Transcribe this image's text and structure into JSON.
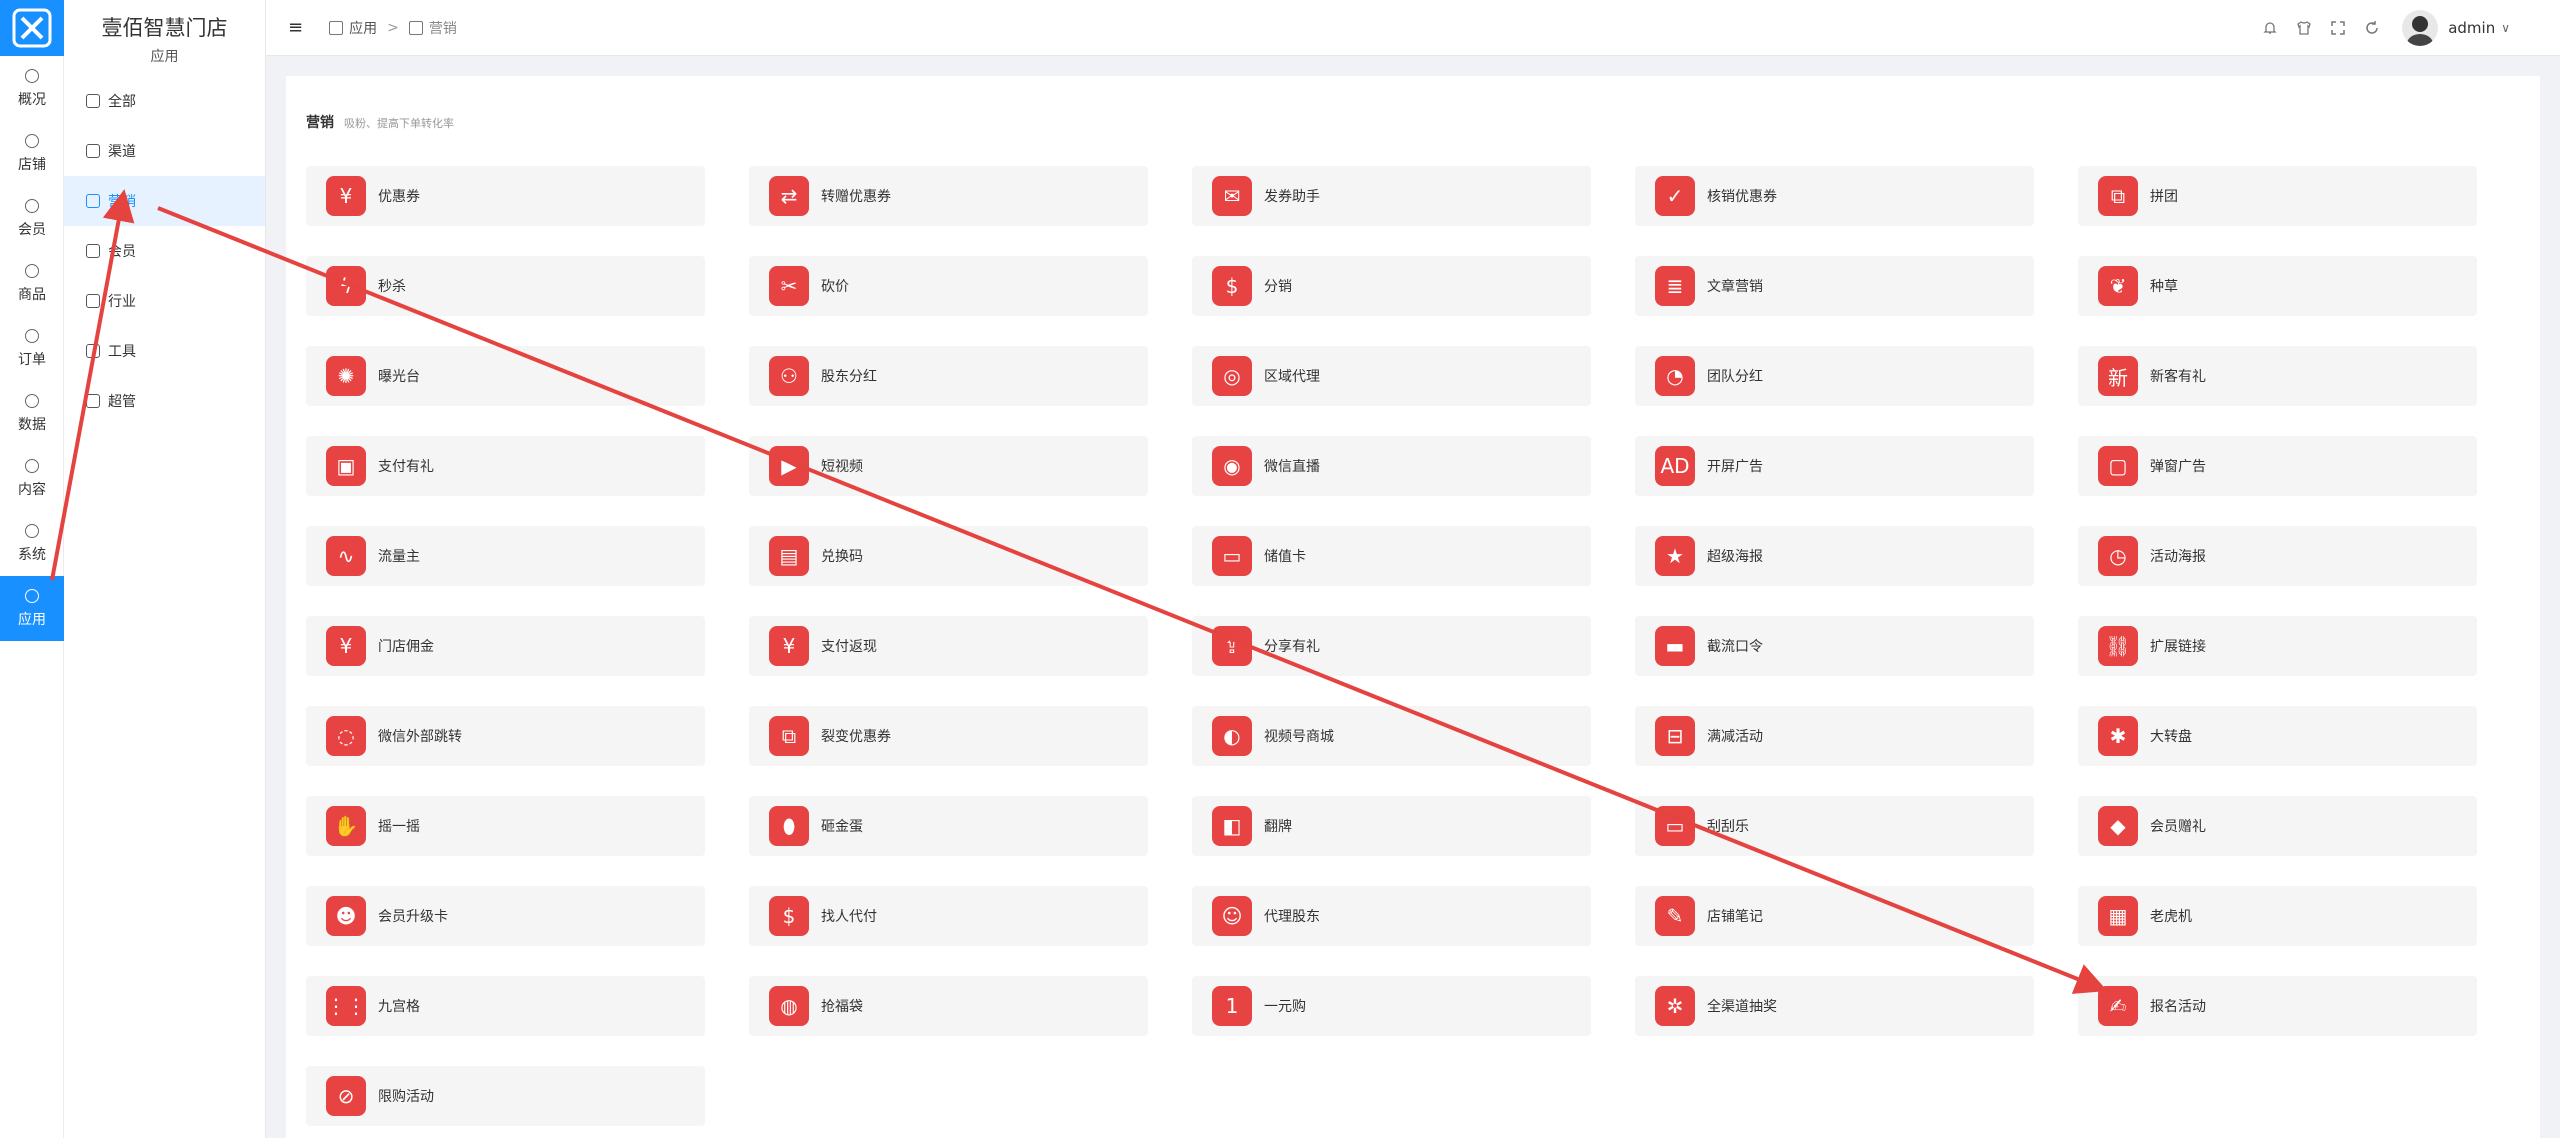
{
  "rail": {
    "items": [
      {
        "label": "概况"
      },
      {
        "label": "店铺"
      },
      {
        "label": "会员"
      },
      {
        "label": "商品"
      },
      {
        "label": "订单"
      },
      {
        "label": "数据"
      },
      {
        "label": "内容"
      },
      {
        "label": "系统"
      },
      {
        "label": "应用",
        "active": true
      }
    ]
  },
  "sidebar": {
    "title": "壹佰智慧门店",
    "subtitle": "应用",
    "items": [
      {
        "label": "全部"
      },
      {
        "label": "渠道"
      },
      {
        "label": "营销",
        "active": true
      },
      {
        "label": "会员"
      },
      {
        "label": "行业"
      },
      {
        "label": "工具"
      },
      {
        "label": "超管"
      }
    ]
  },
  "topbar": {
    "menu_icon": "≡",
    "breadcrumb": [
      "应用",
      "营销"
    ],
    "separator": ">",
    "user": "admin",
    "user_caret": "∨"
  },
  "section": {
    "title": "营销",
    "description": "吸粉、提高下单转化率"
  },
  "apps": [
    {
      "label": "优惠券",
      "icon": "¥"
    },
    {
      "label": "转赠优惠券",
      "icon": "⇄"
    },
    {
      "label": "发券助手",
      "icon": "✉"
    },
    {
      "label": "核销优惠券",
      "icon": "✓"
    },
    {
      "label": "拼团",
      "icon": "⧉"
    },
    {
      "label": "秒杀",
      "icon": "ϟ"
    },
    {
      "label": "砍价",
      "icon": "✂"
    },
    {
      "label": "分销",
      "icon": "$"
    },
    {
      "label": "文章营销",
      "icon": "≣"
    },
    {
      "label": "种草",
      "icon": "❦"
    },
    {
      "label": "曝光台",
      "icon": "✺"
    },
    {
      "label": "股东分红",
      "icon": "⚇"
    },
    {
      "label": "区域代理",
      "icon": "◎"
    },
    {
      "label": "团队分红",
      "icon": "◔"
    },
    {
      "label": "新客有礼",
      "icon": "新"
    },
    {
      "label": "支付有礼",
      "icon": "▣"
    },
    {
      "label": "短视频",
      "icon": "▶"
    },
    {
      "label": "微信直播",
      "icon": "◉"
    },
    {
      "label": "开屏广告",
      "icon": "AD"
    },
    {
      "label": "弹窗广告",
      "icon": "▢"
    },
    {
      "label": "流量主",
      "icon": "∿"
    },
    {
      "label": "兑换码",
      "icon": "▤"
    },
    {
      "label": "储值卡",
      "icon": "▭"
    },
    {
      "label": "超级海报",
      "icon": "★"
    },
    {
      "label": "活动海报",
      "icon": "◷"
    },
    {
      "label": "门店佣金",
      "icon": "¥"
    },
    {
      "label": "支付返现",
      "icon": "¥"
    },
    {
      "label": "分享有礼",
      "icon": "⇪"
    },
    {
      "label": "截流口令",
      "icon": "▬"
    },
    {
      "label": "扩展链接",
      "icon": "⛓"
    },
    {
      "label": "微信外部跳转",
      "icon": "◌"
    },
    {
      "label": "裂变优惠券",
      "icon": "⧉"
    },
    {
      "label": "视频号商城",
      "icon": "◐"
    },
    {
      "label": "满减活动",
      "icon": "⊟"
    },
    {
      "label": "大转盘",
      "icon": "✱"
    },
    {
      "label": "摇一摇",
      "icon": "✋"
    },
    {
      "label": "砸金蛋",
      "icon": "⬮"
    },
    {
      "label": "翻牌",
      "icon": "◧"
    },
    {
      "label": "刮刮乐",
      "icon": "▭"
    },
    {
      "label": "会员赠礼",
      "icon": "◆"
    },
    {
      "label": "会员升级卡",
      "icon": "☻"
    },
    {
      "label": "找人代付",
      "icon": "$"
    },
    {
      "label": "代理股东",
      "icon": "☺"
    },
    {
      "label": "店铺笔记",
      "icon": "✎"
    },
    {
      "label": "老虎机",
      "icon": "▦"
    },
    {
      "label": "九宫格",
      "icon": "⋮⋮"
    },
    {
      "label": "抢福袋",
      "icon": "◍"
    },
    {
      "label": "一元购",
      "icon": "1"
    },
    {
      "label": "全渠道抽奖",
      "icon": "✲"
    },
    {
      "label": "报名活动",
      "icon": "✍"
    },
    {
      "label": "限购活动",
      "icon": "⊘"
    }
  ],
  "colors": {
    "accent": "#1890ff",
    "icon_bg": "#e84343",
    "annotation_arrow": "#e5433f"
  }
}
